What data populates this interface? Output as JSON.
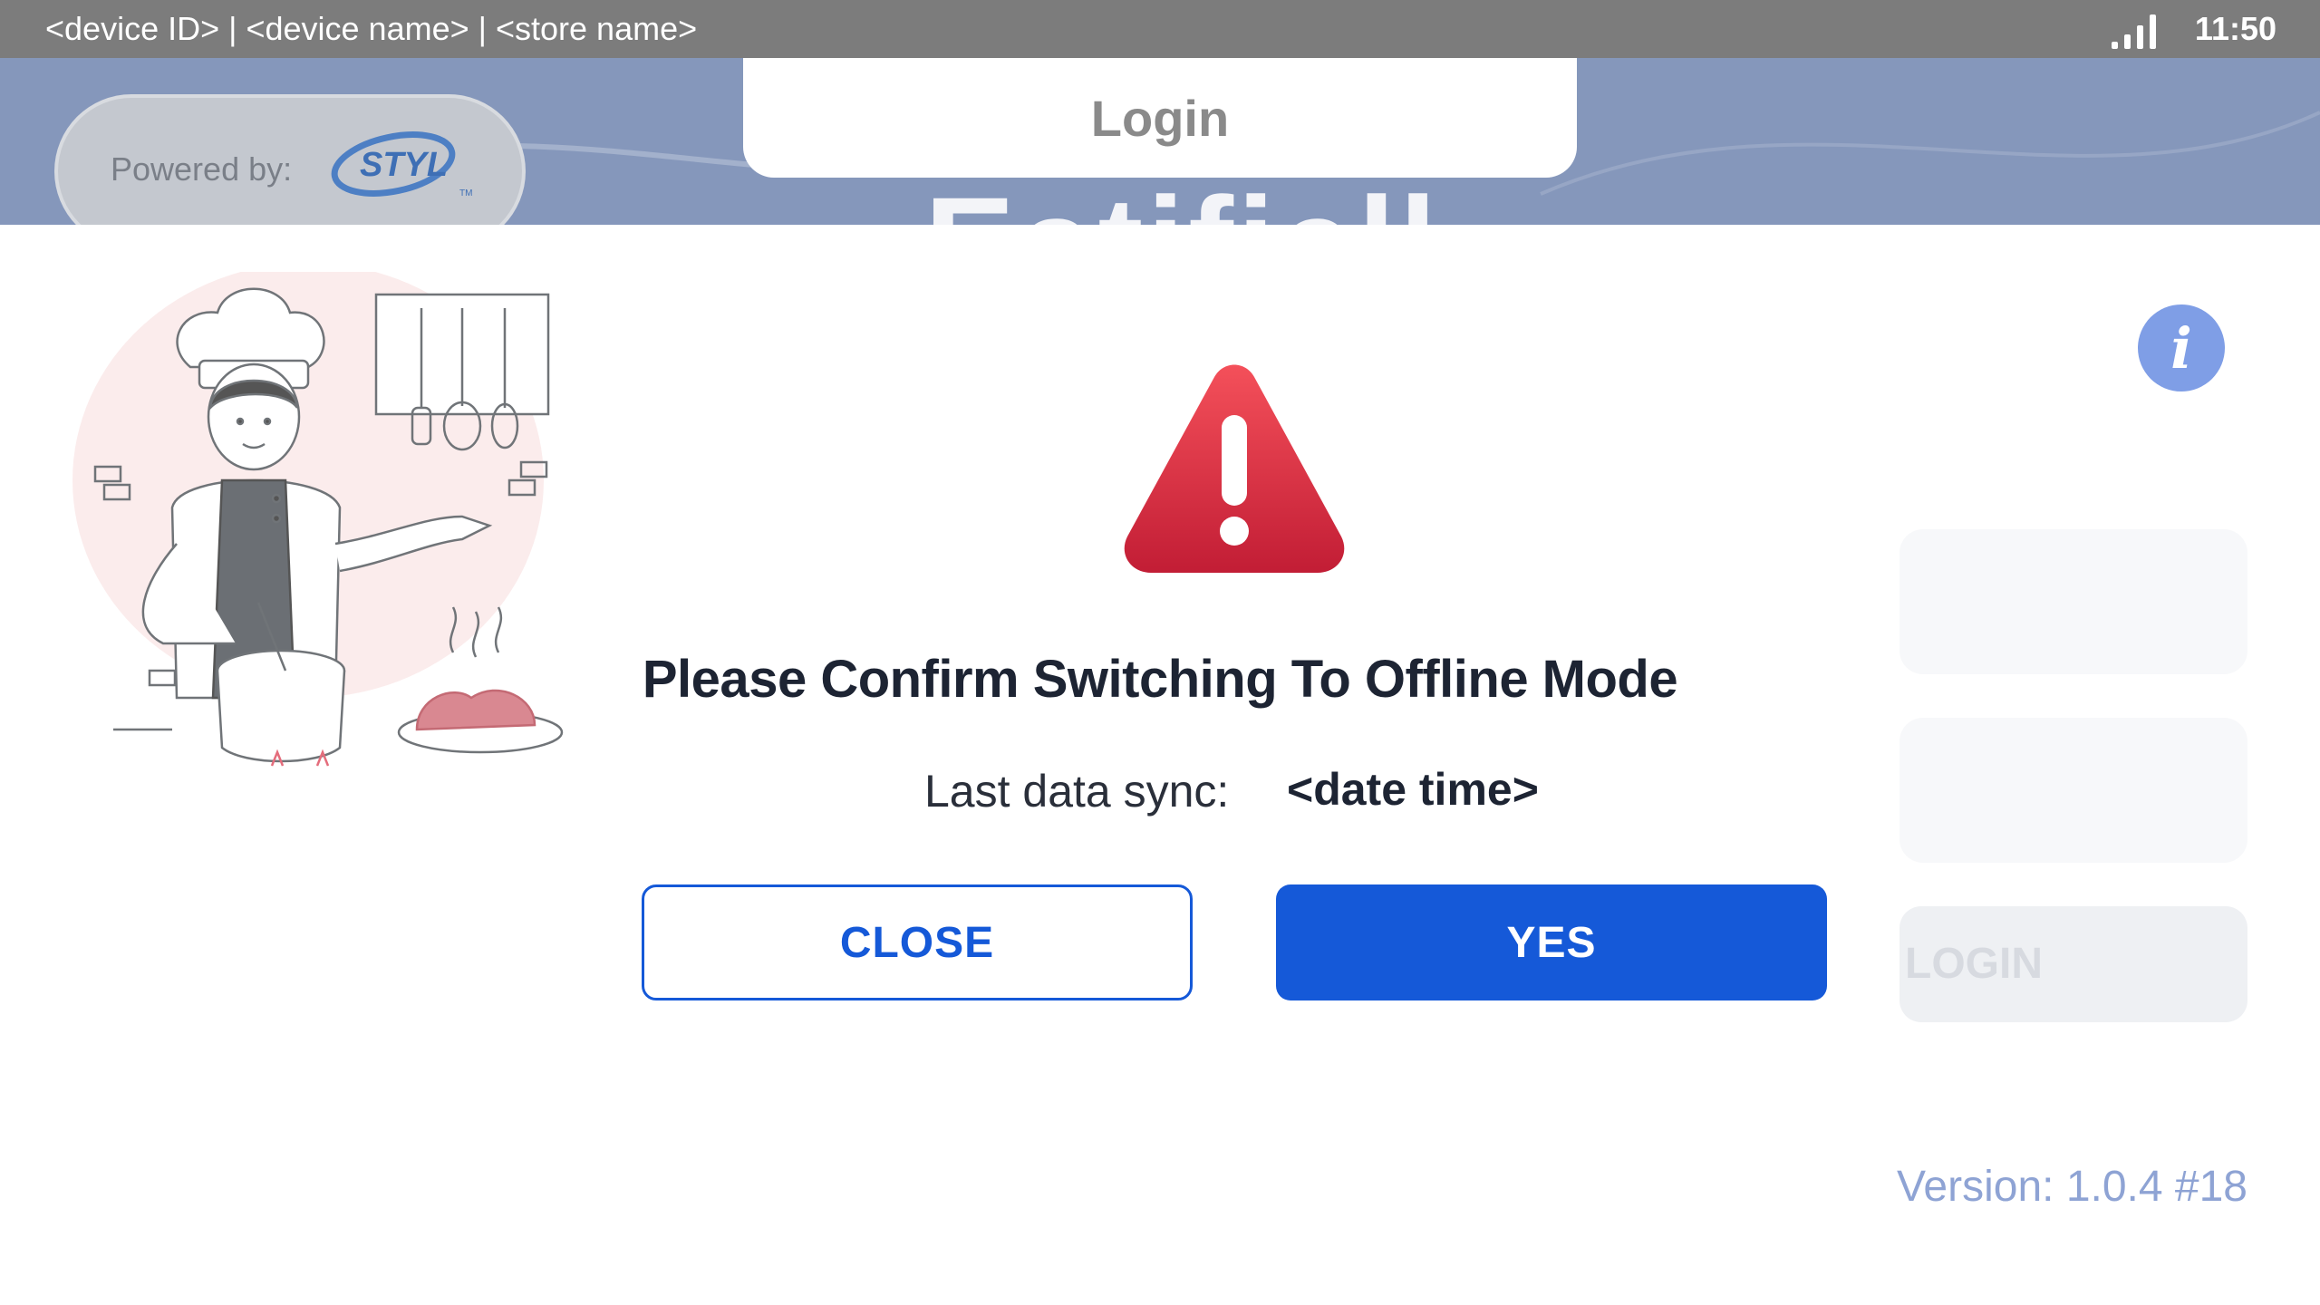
{
  "status_bar": {
    "device_info": "<device ID> | <device name> | <store name>",
    "time": "11:50"
  },
  "header": {
    "powered_by": "Powered by:",
    "logo_text": "STYL",
    "brand_partial": "Eatifiell",
    "title": "Login"
  },
  "dialog": {
    "title": "Please Confirm Switching To Offline Mode",
    "sync_label": "Last data sync:",
    "sync_value": "<date time>",
    "close_label": "CLOSE",
    "yes_label": "YES",
    "icon": "warning-triangle-icon"
  },
  "login_form": {
    "login_label": "LOGIN",
    "info_icon": "info-icon"
  },
  "footer": {
    "version": "Version: 1.0.4 #18"
  },
  "colors": {
    "primary": "#1559d8",
    "status_bar": "#7c7c7c",
    "header_band": "#8597bb",
    "warning": "#d8303f",
    "info": "#7f9ee6"
  }
}
